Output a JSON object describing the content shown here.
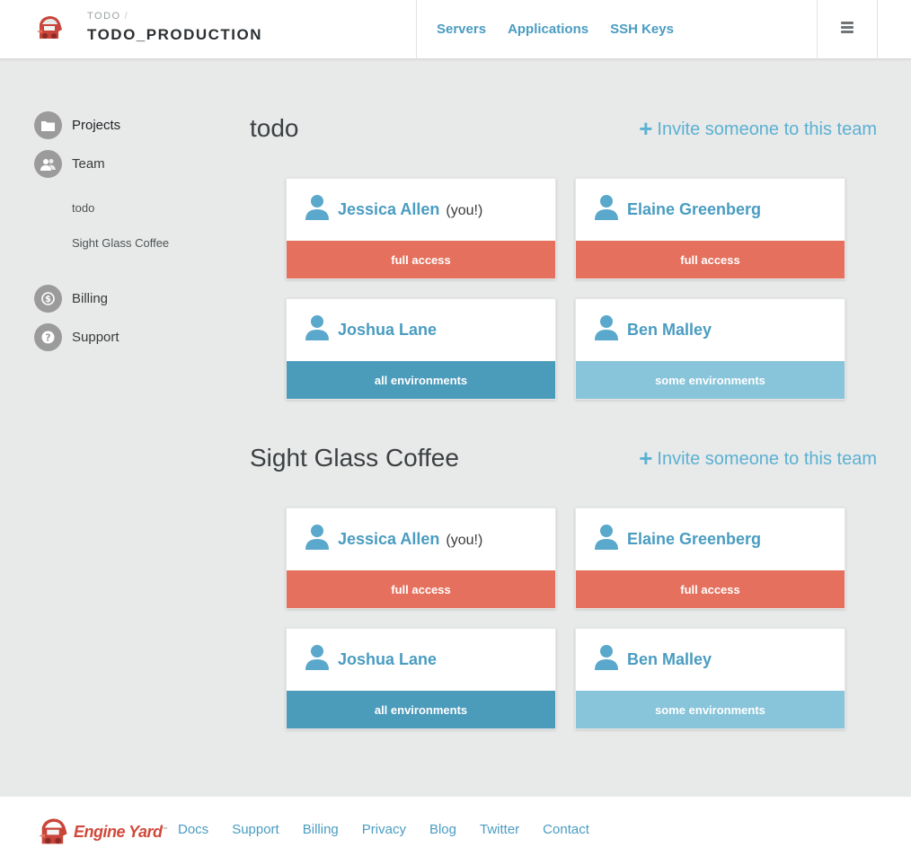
{
  "header": {
    "breadcrumb": "TODO",
    "breadcrumb_sep": "/",
    "title": "TODO_PRODUCTION",
    "nav": [
      "Servers",
      "Applications",
      "SSH Keys"
    ]
  },
  "sidebar": {
    "items": [
      {
        "label": "Projects",
        "icon": "folder-icon"
      },
      {
        "label": "Team",
        "icon": "team-icon"
      },
      {
        "label": "Billing",
        "icon": "dollar-icon"
      },
      {
        "label": "Support",
        "icon": "question-icon"
      }
    ],
    "team_subitems": [
      "todo",
      "Sight Glass Coffee"
    ]
  },
  "teams": [
    {
      "name": "todo",
      "invite_label": "Invite someone to this team",
      "members": [
        {
          "name": "Jessica Allen",
          "suffix": "(you!)",
          "role": "full access"
        },
        {
          "name": "Elaine Greenberg",
          "suffix": "",
          "role": "full access"
        },
        {
          "name": "Joshua Lane",
          "suffix": "",
          "role": "all environments"
        },
        {
          "name": "Ben Malley",
          "suffix": "",
          "role": "some environments"
        }
      ]
    },
    {
      "name": "Sight Glass Coffee",
      "invite_label": "Invite someone to this team",
      "members": [
        {
          "name": "Jessica Allen",
          "suffix": "(you!)",
          "role": "full access"
        },
        {
          "name": "Elaine Greenberg",
          "suffix": "",
          "role": "full access"
        },
        {
          "name": "Joshua Lane",
          "suffix": "",
          "role": "all environments"
        },
        {
          "name": "Ben Malley",
          "suffix": "",
          "role": "some environments"
        }
      ]
    }
  ],
  "footer": {
    "brand": "Engine Yard",
    "trademark": "™",
    "links": [
      "Docs",
      "Support",
      "Billing",
      "Privacy",
      "Blog",
      "Twitter",
      "Contact"
    ]
  },
  "colors": {
    "link": "#4a9cc1",
    "full_access": "#e4705d",
    "all_environments": "#4b9bbb",
    "some_environments": "#88c4da",
    "background": "#e8e9e9"
  }
}
